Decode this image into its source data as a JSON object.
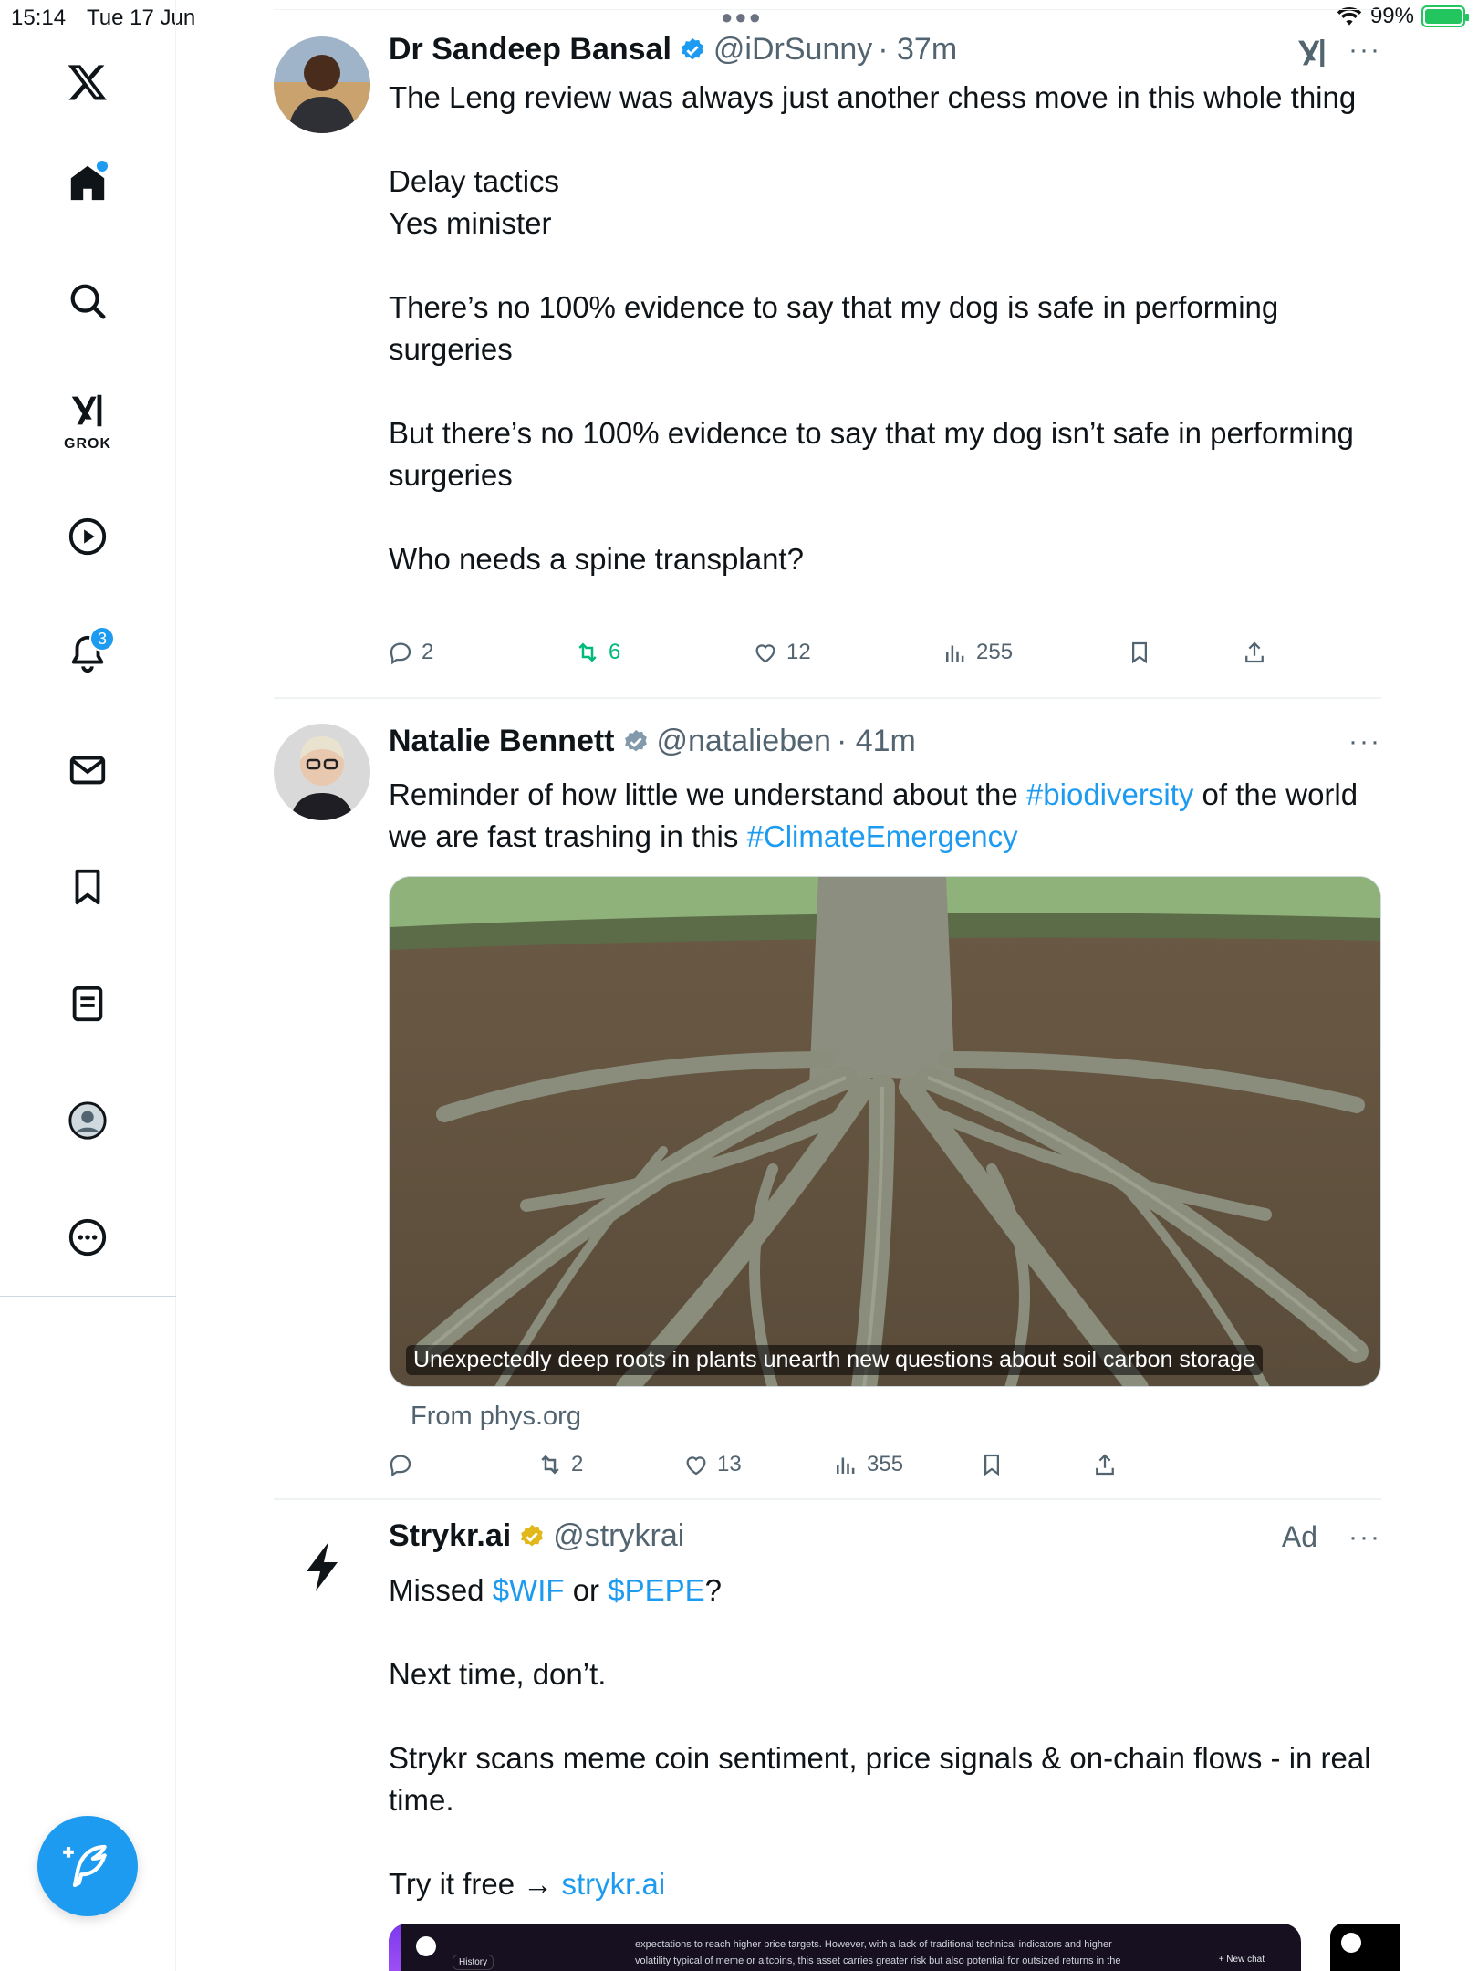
{
  "status": {
    "time": "15:14",
    "date": "Tue 17 Jun",
    "battery": "99%",
    "battery_level": 0.99
  },
  "sidebar": {
    "grok_label": "GROK",
    "notifications_count": "3"
  },
  "tweets": [
    {
      "name": "Dr Sandeep Bansal",
      "handle": "@iDrSunny",
      "time": "· 37m",
      "more": "···",
      "lines": [
        "The Leng review was always just another chess move in this whole thing",
        "",
        "Delay tactics",
        "Yes minister",
        "",
        "There’s no 100% evidence to say that my dog is safe in performing surgeries",
        "",
        "But there’s no 100% evidence to say that my dog isn’t safe in performing surgeries",
        "",
        "Who needs a spine transplant?"
      ],
      "replies": "2",
      "reposts": "6",
      "likes": "12",
      "views": "255"
    },
    {
      "name": "Natalie Bennett",
      "handle": "@natalieben",
      "time": "· 41m",
      "more": "···",
      "text_pre": "Reminder of how little we understand about the ",
      "hashtag1": "#biodiversity",
      "text_mid": " of the world we are fast trashing in this ",
      "hashtag2": "#ClimateEmergency",
      "caption": "Unexpectedly deep roots in plants unearth new questions about soil carbon storage",
      "from": "From phys.org",
      "replies": "",
      "reposts": "2",
      "likes": "13",
      "views": "355"
    },
    {
      "name": "Strykr.ai",
      "handle": "@strykrai",
      "ad": "Ad",
      "more": "···",
      "line1_pre": "Missed ",
      "line1_link1": "$WIF",
      "line1_mid": " or ",
      "line1_link2": "$PEPE",
      "line1_post": "?",
      "line2": "Next time, don’t.",
      "line3": "Strykr scans meme coin sentiment, price signals & on-chain flows - in real time.",
      "line4_pre": "Try it free → ",
      "line4_link": "strykr.ai",
      "preview_history": "History",
      "preview_text": "expectations to reach higher price targets. However, with a lack of traditional technical indicators and higher volatility typical of meme or altcoins, this asset carries greater risk but also potential for outsized returns in the short-term. The overall crypto market sentiment from Bitcoin and other assets should be considered carefully",
      "preview_newchat": "+ New chat"
    }
  ]
}
